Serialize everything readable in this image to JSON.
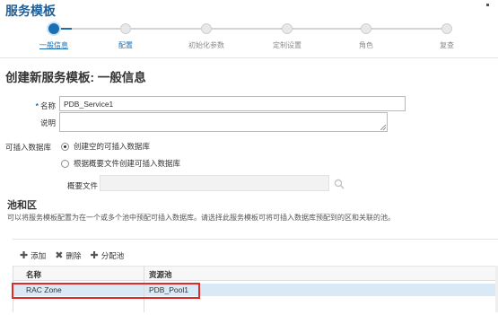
{
  "header": {
    "title": "服务模板"
  },
  "train": {
    "current_index": 0,
    "steps": [
      {
        "label": "一般信息"
      },
      {
        "label": "配置"
      },
      {
        "label": "初始化参数"
      },
      {
        "label": "定制设置"
      },
      {
        "label": "角色"
      },
      {
        "label": "复查"
      }
    ]
  },
  "page": {
    "title": "创建新服务模板: 一般信息"
  },
  "form": {
    "name_label": "名称",
    "name_required_mark": "*",
    "name_value": "PDB_Service1",
    "desc_label": "说明",
    "desc_value": "",
    "pdb_label": "可插入数据库",
    "pdb_options": [
      {
        "label": "创建空的可插入数据库",
        "checked": true
      },
      {
        "label": "根据概要文件创建可插入数据库",
        "checked": false
      }
    ],
    "profile_label": "概要文件",
    "profile_value": ""
  },
  "pool": {
    "title": "池和区",
    "description": "可以将服务模板配置为在一个或多个池中预配可插入数据库。请选择此服务模板可将可插入数据库预配到的区和关联的池。",
    "toolbar": {
      "add_label": "添加",
      "delete_label": "删除",
      "assign_label": "分配池"
    },
    "columns": [
      "名称",
      "资源池"
    ],
    "rows": [
      {
        "name": "RAC Zone",
        "pool": "PDB_Pool1"
      }
    ]
  },
  "colors": {
    "accent": "#1a6eb3",
    "selected_row": "#d9e9f6",
    "highlight": "#e02b2b"
  }
}
